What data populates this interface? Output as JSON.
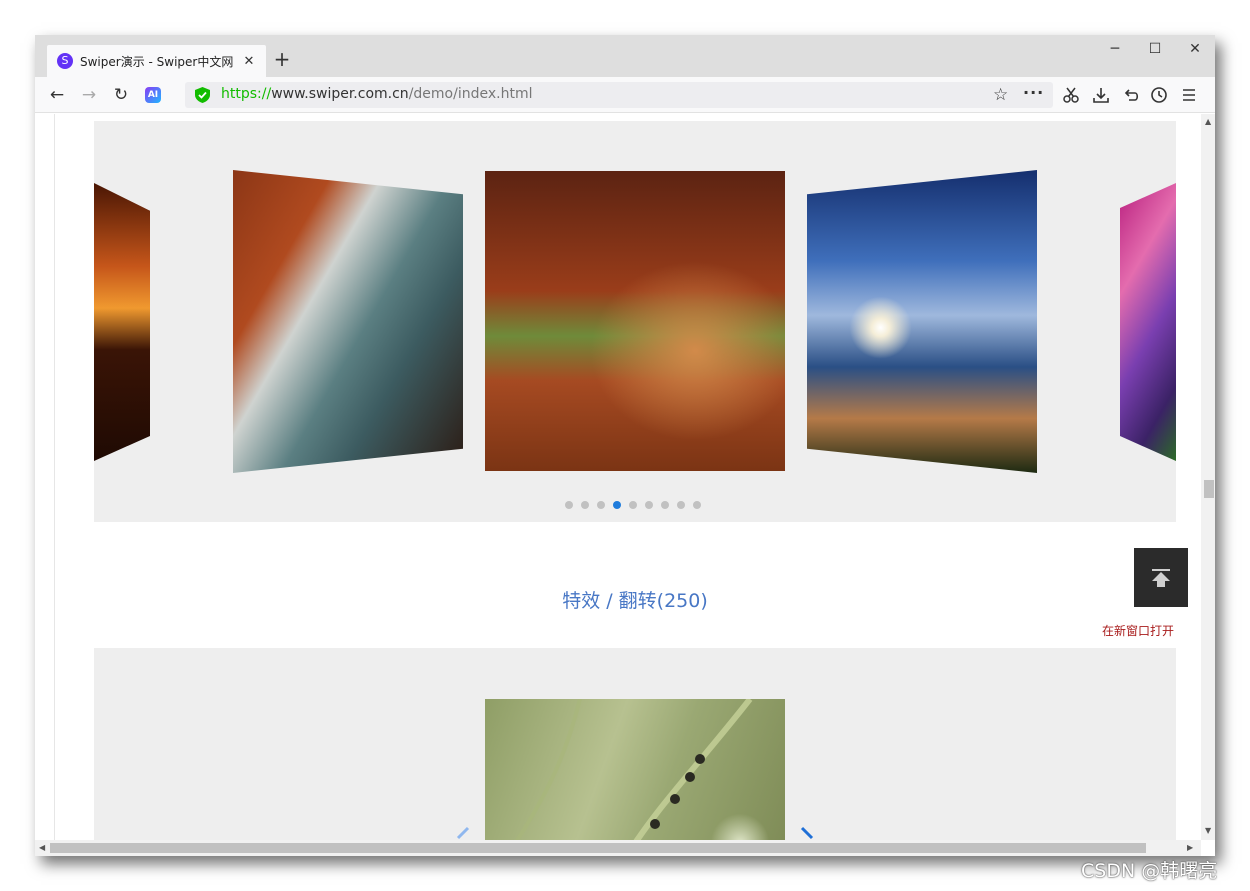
{
  "browser": {
    "tab": {
      "favicon": "S",
      "title": "Swiper演示 - Swiper中文网",
      "close": "✕"
    },
    "new_tab": "+",
    "window_controls": [
      "─",
      "☐",
      "✕"
    ],
    "nav": {
      "back": "←",
      "forward": "→",
      "reload": "↻",
      "ai": "AI"
    },
    "url": {
      "protocol": "https://",
      "host": "www.swiper.com.cn",
      "path": "/demo/index.html"
    },
    "toolbar_icons": [
      "scissors-icon",
      "download-icon",
      "undo-icon",
      "history-icon",
      "menu-icon"
    ]
  },
  "page": {
    "coverflow": {
      "slides": [
        {
          "name": "sunset-lake-slide",
          "colors": [
            "#5c1a05",
            "#d8641a",
            "#f3a03a",
            "#2a0d04"
          ]
        },
        {
          "name": "rocky-coast-slide",
          "colors": [
            "#a6421e",
            "#4d7176",
            "#cfd3d0",
            "#2b1a12"
          ]
        },
        {
          "name": "autumn-trees-slide",
          "colors": [
            "#6b2a12",
            "#b0481e",
            "#8a6a3e",
            "#3b2418"
          ]
        },
        {
          "name": "palm-beach-slide",
          "colors": [
            "#1b3f8a",
            "#5c84c9",
            "#f3efe0",
            "#1d2a12"
          ]
        },
        {
          "name": "pansy-flower-slide",
          "colors": [
            "#c22c8c",
            "#7a3fb0",
            "#e9b531",
            "#3b2266"
          ]
        }
      ],
      "dot_count": 9,
      "active_dot": 4
    },
    "section_title": "特效 / 翻转(250)",
    "open_link": "在新窗口打开",
    "flip_slide": {
      "name": "grass-ants-slide",
      "colors": [
        "#9aa873",
        "#b8c08f",
        "#6f7d4b"
      ]
    }
  },
  "watermark": "CSDN @韩曙亮"
}
